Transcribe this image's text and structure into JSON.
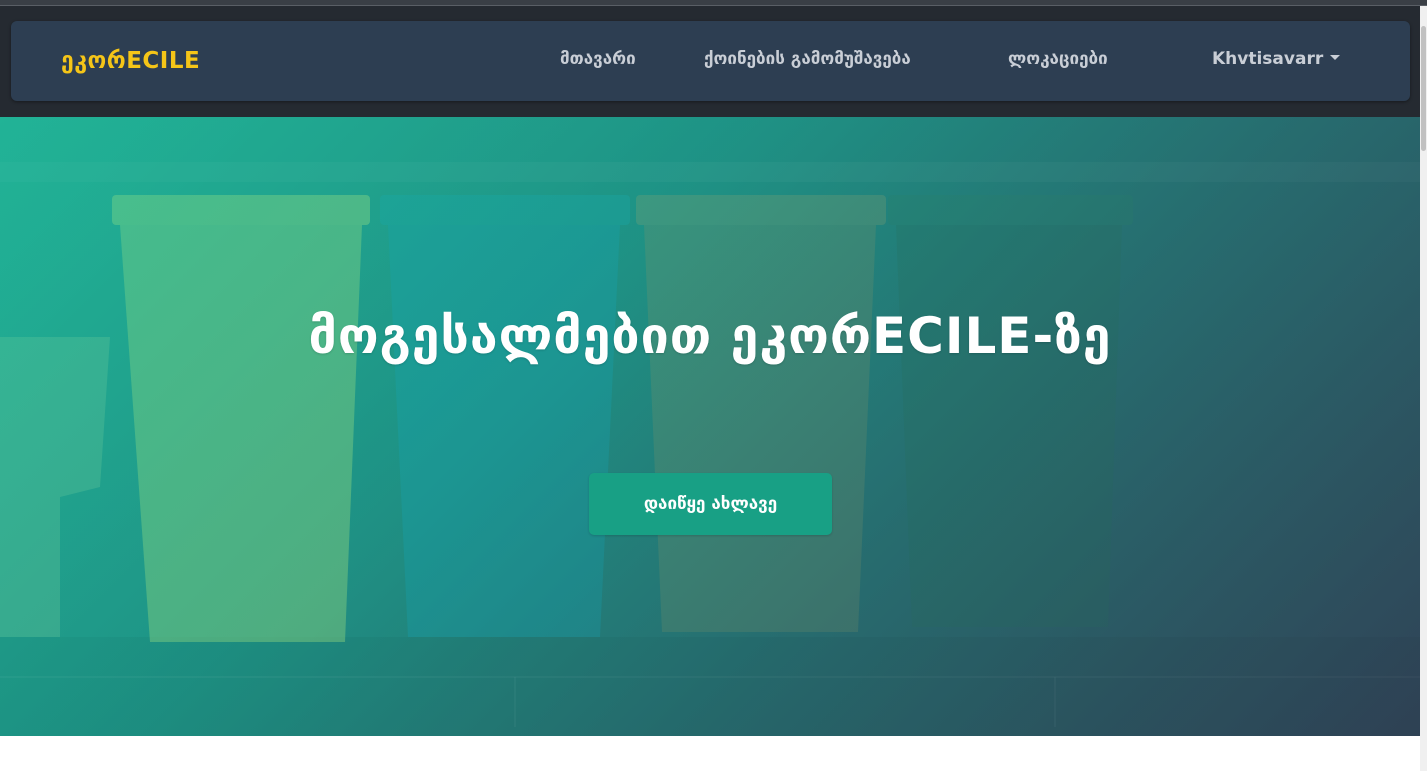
{
  "navbar": {
    "brand": "ეკორECILE",
    "links": {
      "home": "მთავარი",
      "recycling": "ქოინების გამომუშავება",
      "locations": "ლოკაციები",
      "user": "Khvtisavarr"
    }
  },
  "hero": {
    "title": "მოგესალმებით ეკორECILE-ზე",
    "cta_label": "დაიწყე ახლავე"
  },
  "colors": {
    "brand": "#f5c518",
    "navbar_bg": "#2d3e52",
    "cta_bg": "#18a085",
    "hero_start": "#1abc9c",
    "hero_end": "#2c3e50"
  }
}
